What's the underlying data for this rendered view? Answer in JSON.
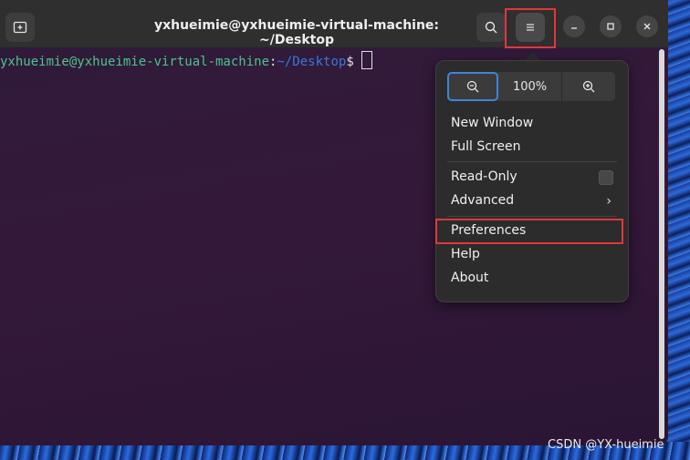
{
  "window": {
    "title": "yxhueimie@yxhueimie-virtual-machine: ~/Desktop"
  },
  "terminal": {
    "prompt_user_host": "yxhueimie@yxhueimie-virtual-machine",
    "prompt_colon": ":",
    "prompt_path": "~/Desktop",
    "prompt_symbol": "$"
  },
  "menu": {
    "zoom_level": "100%",
    "items": [
      {
        "label": "New Window"
      },
      {
        "label": "Full Screen"
      },
      {
        "label": "Read-Only"
      },
      {
        "label": "Advanced"
      },
      {
        "label": "Preferences"
      },
      {
        "label": "Help"
      },
      {
        "label": "About"
      }
    ]
  },
  "icons": {
    "new_tab": "new-tab-icon",
    "search": "search-icon",
    "hamburger": "hamburger-menu-icon",
    "minimize": "minimize-icon",
    "maximize": "maximize-icon",
    "close": "close-icon",
    "zoom_out": "zoom-out-icon",
    "zoom_in": "zoom-in-icon",
    "submenu": "chevron-right-icon"
  },
  "colors": {
    "highlight": "#e0373d",
    "prompt_user": "#4cc58a",
    "prompt_path": "#3b77d9",
    "focus_ring": "#3d86d9"
  },
  "watermark": "CSDN @YX-hueimie"
}
